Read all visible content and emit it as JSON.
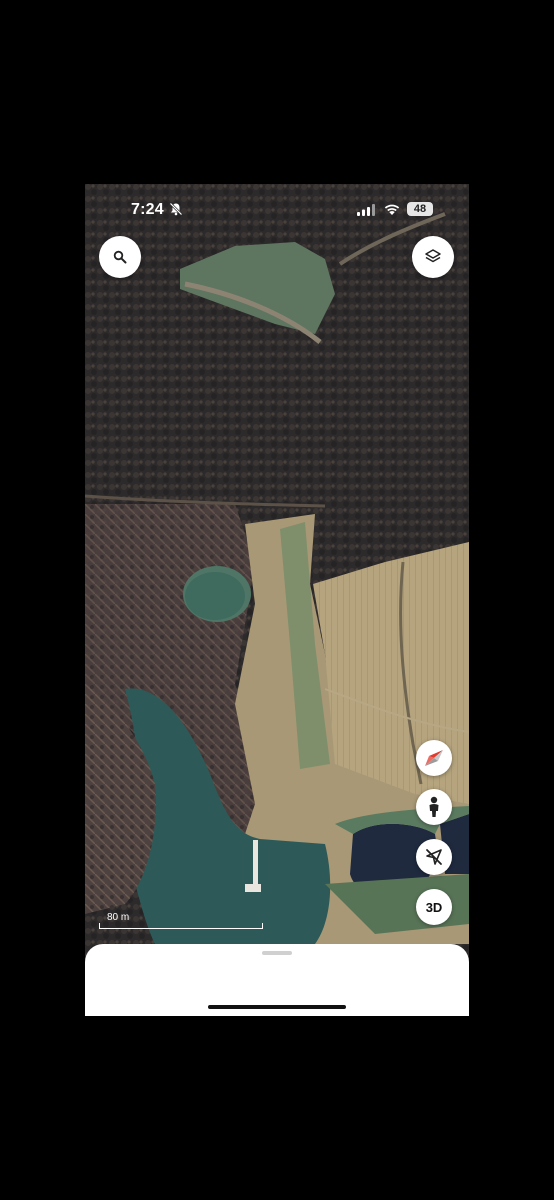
{
  "status_bar": {
    "time": "7:24",
    "battery": "48"
  },
  "map": {
    "scale_label": "80 m",
    "view": "satellite"
  },
  "controls": {
    "three_d_label": "3D"
  },
  "colors": {
    "forest": "#2f2b2a",
    "water": "#2c5a58",
    "field": "#b6a47c",
    "grass": "#56735a"
  }
}
